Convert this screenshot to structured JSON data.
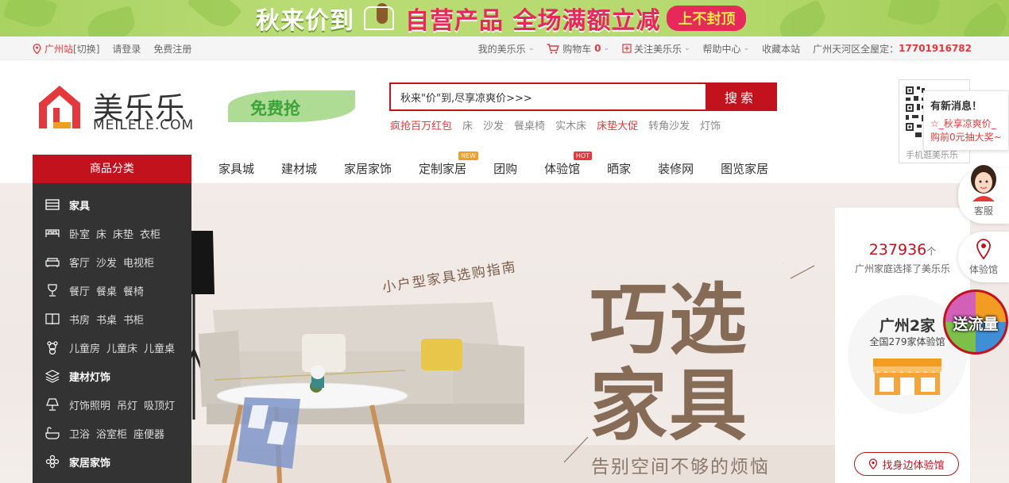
{
  "banner": {
    "text1": "秋来价到",
    "text2": "自营产品 全场满额立减",
    "pill": "上不封顶"
  },
  "topbar": {
    "city": "广州站",
    "switch": "[切换]",
    "login": "请登录",
    "register": "免费注册",
    "my_account": "我的美乐乐",
    "cart_label": "购物车",
    "cart_count": "0",
    "follow": "关注美乐乐",
    "help": "帮助中心",
    "favorite": "收藏本站",
    "delivery": "广州天河区全屋定：",
    "phone": "17701916782"
  },
  "header": {
    "logo_cn": "美乐乐",
    "logo_en": "MEILELE.COM",
    "free_buy": "免费抢",
    "search_value": "秋来\"价\"到,尽享凉爽价>>>",
    "search_button": "搜索",
    "hotwords": [
      {
        "text": "疯抢百万红包",
        "hot": true
      },
      {
        "text": "床",
        "hot": false
      },
      {
        "text": "沙发",
        "hot": false
      },
      {
        "text": "餐桌椅",
        "hot": false
      },
      {
        "text": "实木床",
        "hot": false
      },
      {
        "text": "床垫大促",
        "hot": true
      },
      {
        "text": "转角沙发",
        "hot": false
      },
      {
        "text": "灯饰",
        "hot": false
      }
    ],
    "qr_label": "手机逛美乐乐",
    "news_title": "有新消息！",
    "news_line1": "☆_秋享凉爽价_",
    "news_line2": "购前0元抽大奖~"
  },
  "nav": {
    "category_title": "商品分类",
    "items": [
      {
        "label": "家具城",
        "badge": ""
      },
      {
        "label": "建材城",
        "badge": ""
      },
      {
        "label": "家居家饰",
        "badge": ""
      },
      {
        "label": "定制家居",
        "badge": "NEW"
      },
      {
        "label": "团购",
        "badge": ""
      },
      {
        "label": "体验馆",
        "badge": "HOT"
      },
      {
        "label": "晒家",
        "badge": ""
      },
      {
        "label": "装修网",
        "badge": ""
      },
      {
        "label": "图览家居",
        "badge": ""
      }
    ]
  },
  "sidebar": {
    "rows": [
      {
        "icon": "furniture-icon",
        "head": "家具",
        "subs": []
      },
      {
        "icon": "bed-icon",
        "head": "",
        "subs": [
          "卧室",
          "床",
          "床垫",
          "衣柜"
        ]
      },
      {
        "icon": "sofa-icon",
        "head": "",
        "subs": [
          "客厅",
          "沙发",
          "电视柜"
        ]
      },
      {
        "icon": "wine-glass-icon",
        "head": "",
        "subs": [
          "餐厅",
          "餐桌",
          "餐椅"
        ]
      },
      {
        "icon": "book-icon",
        "head": "",
        "subs": [
          "书房",
          "书桌",
          "书柜"
        ]
      },
      {
        "icon": "teddy-bear-icon",
        "head": "",
        "subs": [
          "儿童房",
          "儿童床",
          "儿童桌"
        ]
      },
      {
        "icon": "layers-icon",
        "head": "建材灯饰",
        "subs": []
      },
      {
        "icon": "lamp-icon",
        "head": "",
        "subs": [
          "灯饰照明",
          "吊灯",
          "吸顶灯"
        ]
      },
      {
        "icon": "bathtub-icon",
        "head": "",
        "subs": [
          "卫浴",
          "浴室柜",
          "座便器"
        ]
      },
      {
        "icon": "flower-icon",
        "head": "家居家饰",
        "subs": []
      }
    ]
  },
  "hero": {
    "guide": "小户型家具选购指南",
    "title1": "巧选",
    "title2": "家具",
    "subtitle": "告别空间不够的烦恼"
  },
  "stats": {
    "count": "237936",
    "count_unit": "个",
    "desc": "广州家庭选择了美乐乐",
    "city_stores": "广州2家",
    "national": "全国279家体验馆",
    "find_button": "找身边体验馆"
  },
  "float": {
    "service": "客服",
    "experience": "体验馆",
    "traffic": "送流量"
  }
}
